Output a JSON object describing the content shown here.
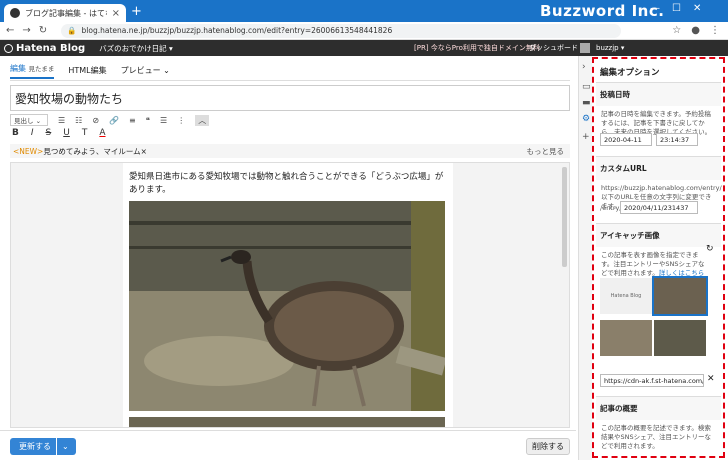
{
  "browser": {
    "tab_title": "ブログ記事編集 - はてなブログ",
    "tab_close": "×",
    "new_tab": "+",
    "brand": "Buzzword Inc.",
    "url": "blog.hatena.ne.jp/buzzjp/buzzjp.hatenablog.com/edit?entry=26006613548441826",
    "controls": [
      "—",
      "☐",
      "✕"
    ]
  },
  "hatena_bar": {
    "logo": "Hatena Blog",
    "blog_name": "バズのおでかけ日記 ▾",
    "promo": "[PR] 今ならPro利用で独自ドメイン無料",
    "dashboard": "ダッシュボード",
    "user": "buzzjp ▾"
  },
  "editor": {
    "tabs": [
      {
        "label": "編集",
        "sub": "見たまま"
      },
      {
        "label": "HTML編集"
      },
      {
        "label": "プレビュー ⌄"
      }
    ],
    "title": "愛知牧場の動物たち",
    "heading_select": "見出し ⌄",
    "toolbar_row1": [
      "☰",
      "☷",
      "⊘",
      "🔗",
      "≡",
      "❝",
      "☰",
      "⋮"
    ],
    "toolbar_row2": [
      "B",
      "I",
      "S",
      "U",
      "T",
      "A"
    ],
    "notice_tag": "<NEW>",
    "notice_text": "見つめてみよう、マイルーム×",
    "notice_more": "もっと見る",
    "body_text": "愛知県日進市にある愛知牧場では動物と触れ合うことができる「どうぶつ広場」があります。"
  },
  "bottom": {
    "update_label": "更新する",
    "update_arrow": "⌄",
    "delete_label": "削除する"
  },
  "panel": {
    "title": "編集オプション",
    "date_section": {
      "heading": "投稿日時",
      "desc": "記事の日時を編集できます。予約投稿するには、記事を下書きに戻してから、未来の日時を選択してください。",
      "date": "2020-04-11",
      "time": "23:14:37"
    },
    "url_section": {
      "heading": "カスタムURL",
      "desc": "https://buzzjp.hatenablog.com/entry/以下のURLを任意の文字列に変更できます。",
      "prefix": "/entry/",
      "value": "2020/04/11/231437"
    },
    "eyecatch_section": {
      "heading": "アイキャッチ画像",
      "desc": "この記事を表す画像を指定できます。注目エントリーやSNSシェアなどで利用されます。",
      "link": "詳しくはこちら",
      "thumb_logo": "Hatena Blog",
      "image_url": "https://cdn-ak.f.st-hatena.com/image",
      "clear": "✕"
    },
    "summary_section": {
      "heading": "記事の概要",
      "desc": "この記事の概要を記述できます。検索結果やSNSシェア、注目エントリーなどで利用されます。"
    }
  }
}
